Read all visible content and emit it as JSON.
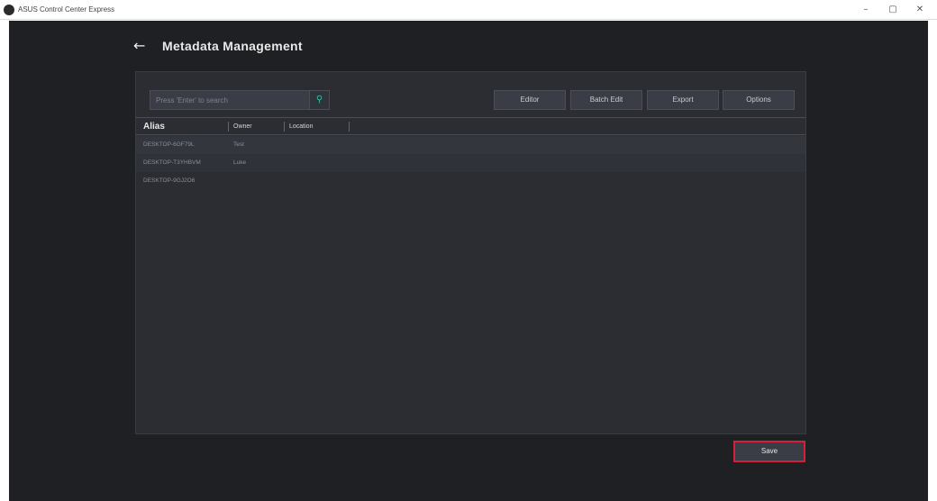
{
  "window": {
    "title": "ASUS Control Center Express",
    "controls": {
      "minimize": "–",
      "maximize": "▢",
      "close": "✕"
    }
  },
  "header": {
    "back_icon": "arrow-left-icon",
    "title": "Metadata Management"
  },
  "toolbar": {
    "search": {
      "placeholder": "Press 'Enter' to search",
      "value": "",
      "icon": "search-icon"
    },
    "buttons": [
      {
        "label": "Editor"
      },
      {
        "label": "Batch Edit"
      },
      {
        "label": "Export"
      },
      {
        "label": "Options"
      }
    ]
  },
  "table": {
    "columns": [
      "Alias",
      "Owner",
      "Location"
    ],
    "rows": [
      {
        "alias": "DESKTOP-6GF79L",
        "owner": "Test"
      },
      {
        "alias": "DESKTOP-T3YHBVM",
        "owner": "Luke"
      },
      {
        "alias": "DESKTOP-9GJ2O6",
        "owner": ""
      }
    ]
  },
  "footer": {
    "save_label": "Save"
  },
  "colors": {
    "app_background": "#1f2024",
    "panel_background": "#2b2d33",
    "accent_search": "#29c3a0",
    "save_highlight": "#d3213a"
  }
}
